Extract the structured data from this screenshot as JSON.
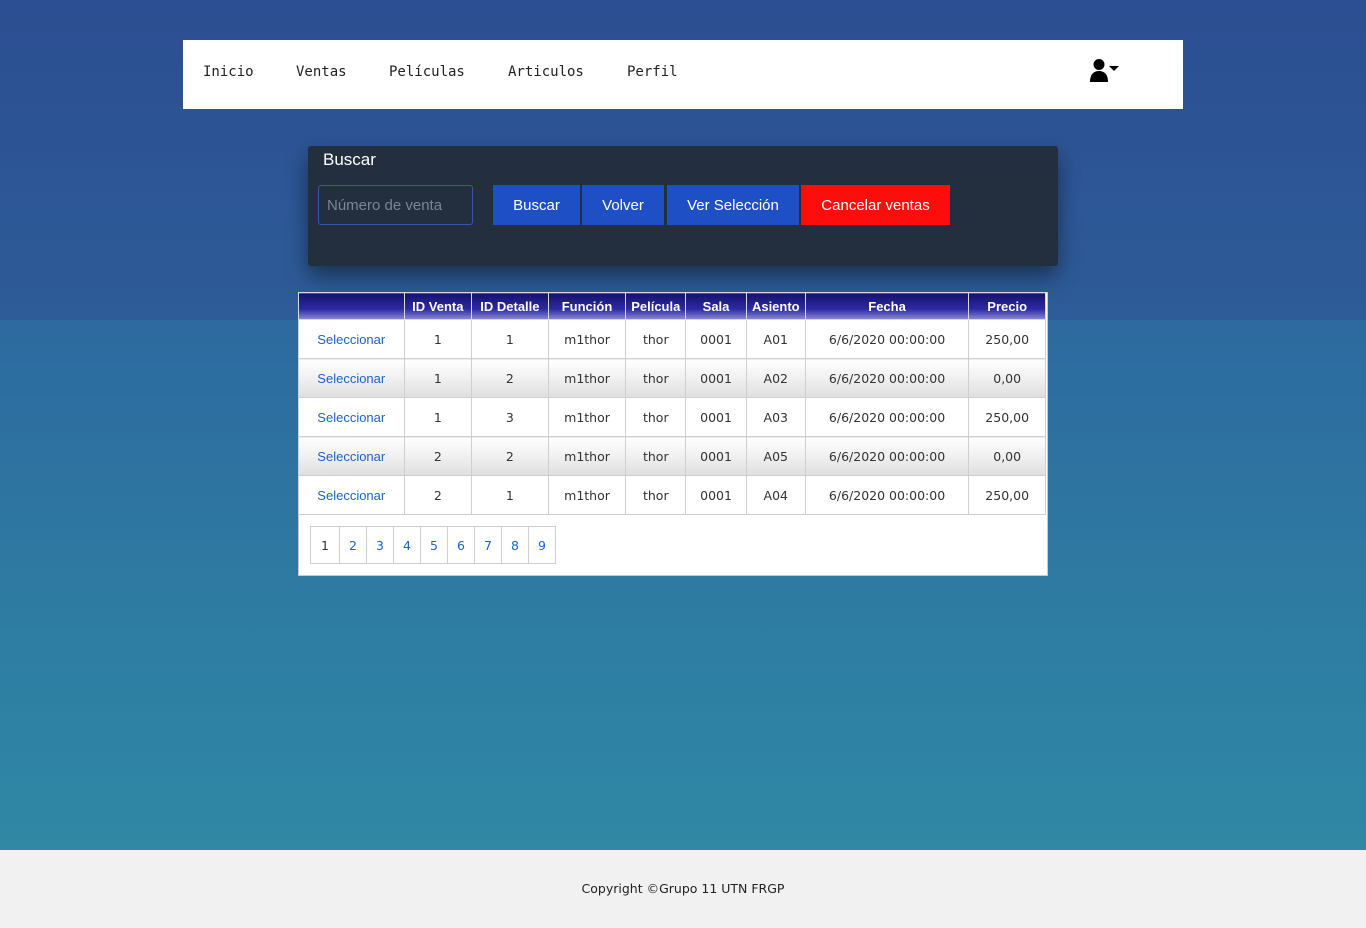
{
  "nav": {
    "items": [
      {
        "label": "Inicio"
      },
      {
        "label": "Ventas"
      },
      {
        "label": "Películas"
      },
      {
        "label": "Articulos"
      },
      {
        "label": "Perfil"
      }
    ],
    "user_icon": "user-dropdown-icon"
  },
  "search": {
    "title": "Buscar",
    "placeholder": "Número de venta",
    "value": "",
    "buttons": {
      "buscar": "Buscar",
      "volver": "Volver",
      "ver_seleccion": "Ver Selección",
      "cancelar": "Cancelar ventas"
    }
  },
  "grid": {
    "headers": [
      "",
      "ID Venta",
      "ID Detalle",
      "Función",
      "Película",
      "Sala",
      "Asiento",
      "Fecha",
      "Precio"
    ],
    "rows": [
      {
        "action": "Seleccionar",
        "id_venta": "1",
        "id_detalle": "1",
        "funcion": "m1thor",
        "pelicula": "thor",
        "sala": "0001",
        "asiento": "A01",
        "fecha": "6/6/2020 00:00:00",
        "precio": "250,00"
      },
      {
        "action": "Seleccionar",
        "id_venta": "1",
        "id_detalle": "2",
        "funcion": "m1thor",
        "pelicula": "thor",
        "sala": "0001",
        "asiento": "A02",
        "fecha": "6/6/2020 00:00:00",
        "precio": "0,00"
      },
      {
        "action": "Seleccionar",
        "id_venta": "1",
        "id_detalle": "3",
        "funcion": "m1thor",
        "pelicula": "thor",
        "sala": "0001",
        "asiento": "A03",
        "fecha": "6/6/2020 00:00:00",
        "precio": "250,00"
      },
      {
        "action": "Seleccionar",
        "id_venta": "2",
        "id_detalle": "2",
        "funcion": "m1thor",
        "pelicula": "thor",
        "sala": "0001",
        "asiento": "A05",
        "fecha": "6/6/2020 00:00:00",
        "precio": "0,00"
      },
      {
        "action": "Seleccionar",
        "id_venta": "2",
        "id_detalle": "1",
        "funcion": "m1thor",
        "pelicula": "thor",
        "sala": "0001",
        "asiento": "A04",
        "fecha": "6/6/2020 00:00:00",
        "precio": "250,00"
      }
    ],
    "pages": [
      "1",
      "2",
      "3",
      "4",
      "5",
      "6",
      "7",
      "8",
      "9"
    ],
    "current_page": "1"
  },
  "footer": {
    "copyright": "Copyright ©Grupo 11 UTN FRGP"
  },
  "colors": {
    "button_blue": "#1f4fc4",
    "button_red": "#ff0d0d",
    "link_blue": "#1a63c9",
    "panel_dark": "#232f3e"
  }
}
